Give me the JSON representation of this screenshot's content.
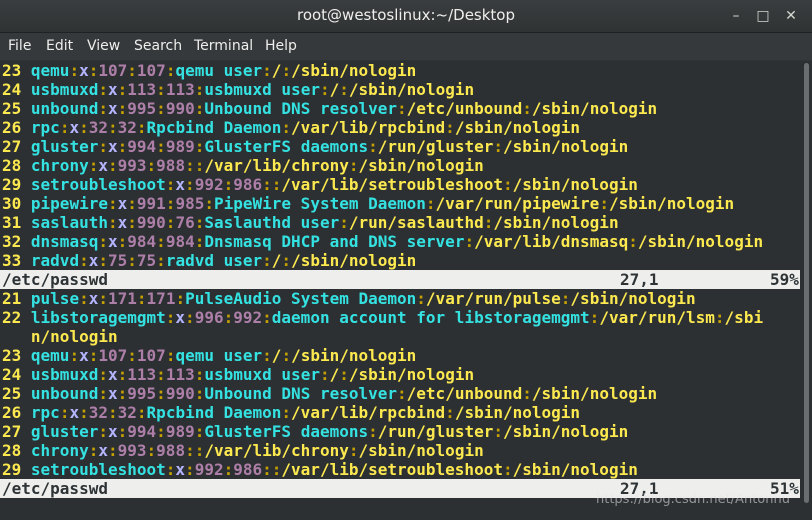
{
  "window": {
    "title": "root@westoslinux:~/Desktop"
  },
  "menu": [
    "File",
    "Edit",
    "View",
    "Search",
    "Terminal",
    "Help"
  ],
  "top_pane": {
    "lines": [
      {
        "n": "23",
        "parts": [
          [
            "user",
            "qemu"
          ],
          [
            "col",
            ":"
          ],
          [
            "x",
            "x"
          ],
          [
            "col",
            ":"
          ],
          [
            "num",
            "107"
          ],
          [
            "col",
            ":"
          ],
          [
            "num",
            "107"
          ],
          [
            "col",
            ":"
          ],
          [
            "desc",
            "qemu user"
          ],
          [
            "col",
            ":"
          ],
          [
            "path",
            "/"
          ],
          [
            "col",
            ":"
          ],
          [
            "path",
            "/sbin/nologin"
          ]
        ]
      },
      {
        "n": "24",
        "parts": [
          [
            "user",
            "usbmuxd"
          ],
          [
            "col",
            ":"
          ],
          [
            "x",
            "x"
          ],
          [
            "col",
            ":"
          ],
          [
            "num",
            "113"
          ],
          [
            "col",
            ":"
          ],
          [
            "num",
            "113"
          ],
          [
            "col",
            ":"
          ],
          [
            "desc",
            "usbmuxd user"
          ],
          [
            "col",
            ":"
          ],
          [
            "path",
            "/"
          ],
          [
            "col",
            ":"
          ],
          [
            "path",
            "/sbin/nologin"
          ]
        ]
      },
      {
        "n": "25",
        "parts": [
          [
            "user",
            "unbound"
          ],
          [
            "col",
            ":"
          ],
          [
            "x",
            "x"
          ],
          [
            "col",
            ":"
          ],
          [
            "num",
            "995"
          ],
          [
            "col",
            ":"
          ],
          [
            "num",
            "990"
          ],
          [
            "col",
            ":"
          ],
          [
            "desc",
            "Unbound DNS resolver"
          ],
          [
            "col",
            ":"
          ],
          [
            "path",
            "/etc/unbound"
          ],
          [
            "col",
            ":"
          ],
          [
            "path",
            "/sbin/nologin"
          ]
        ]
      },
      {
        "n": "26",
        "parts": [
          [
            "user",
            "rpc"
          ],
          [
            "col",
            ":"
          ],
          [
            "x",
            "x"
          ],
          [
            "col",
            ":"
          ],
          [
            "num",
            "32"
          ],
          [
            "col",
            ":"
          ],
          [
            "num",
            "32"
          ],
          [
            "col",
            ":"
          ],
          [
            "desc",
            "Rpcbind Daemon"
          ],
          [
            "col",
            ":"
          ],
          [
            "path",
            "/var/lib/rpcbind"
          ],
          [
            "col",
            ":"
          ],
          [
            "path",
            "/sbin/nologin"
          ]
        ]
      },
      {
        "n": "27",
        "parts": [
          [
            "user",
            "gluster"
          ],
          [
            "col",
            ":"
          ],
          [
            "x",
            "x"
          ],
          [
            "col",
            ":"
          ],
          [
            "num",
            "994"
          ],
          [
            "col",
            ":"
          ],
          [
            "num",
            "989"
          ],
          [
            "col",
            ":"
          ],
          [
            "desc",
            "GlusterFS daemons"
          ],
          [
            "col",
            ":"
          ],
          [
            "path",
            "/run/gluster"
          ],
          [
            "col",
            ":"
          ],
          [
            "path",
            "/sbin/nologin"
          ]
        ]
      },
      {
        "n": "28",
        "parts": [
          [
            "user",
            "chrony"
          ],
          [
            "col",
            ":"
          ],
          [
            "x",
            "x"
          ],
          [
            "col",
            ":"
          ],
          [
            "num",
            "993"
          ],
          [
            "col",
            ":"
          ],
          [
            "num",
            "988"
          ],
          [
            "col",
            "::"
          ],
          [
            "path",
            "/var/lib/chrony"
          ],
          [
            "col",
            ":"
          ],
          [
            "path",
            "/sbin/nologin"
          ]
        ]
      },
      {
        "n": "29",
        "parts": [
          [
            "user",
            "setroubleshoot"
          ],
          [
            "col",
            ":"
          ],
          [
            "x",
            "x"
          ],
          [
            "col",
            ":"
          ],
          [
            "num",
            "992"
          ],
          [
            "col",
            ":"
          ],
          [
            "num",
            "986"
          ],
          [
            "col",
            "::"
          ],
          [
            "path",
            "/var/lib/setroubleshoot"
          ],
          [
            "col",
            ":"
          ],
          [
            "path",
            "/sbin/nologin"
          ]
        ]
      },
      {
        "n": "30",
        "parts": [
          [
            "user",
            "pipewire"
          ],
          [
            "col",
            ":"
          ],
          [
            "x",
            "x"
          ],
          [
            "col",
            ":"
          ],
          [
            "num",
            "991"
          ],
          [
            "col",
            ":"
          ],
          [
            "num",
            "985"
          ],
          [
            "col",
            ":"
          ],
          [
            "desc",
            "PipeWire System Daemon"
          ],
          [
            "col",
            ":"
          ],
          [
            "path",
            "/var/run/pipewire"
          ],
          [
            "col",
            ":"
          ],
          [
            "path",
            "/sbin/nologin"
          ]
        ]
      },
      {
        "n": "31",
        "parts": [
          [
            "user",
            "saslauth"
          ],
          [
            "col",
            ":"
          ],
          [
            "x",
            "x"
          ],
          [
            "col",
            ":"
          ],
          [
            "num",
            "990"
          ],
          [
            "col",
            ":"
          ],
          [
            "num",
            "76"
          ],
          [
            "col",
            ":"
          ],
          [
            "desc",
            "Saslauthd user"
          ],
          [
            "col",
            ":"
          ],
          [
            "path",
            "/run/saslauthd"
          ],
          [
            "col",
            ":"
          ],
          [
            "path",
            "/sbin/nologin"
          ]
        ]
      },
      {
        "n": "32",
        "parts": [
          [
            "user",
            "dnsmasq"
          ],
          [
            "col",
            ":"
          ],
          [
            "x",
            "x"
          ],
          [
            "col",
            ":"
          ],
          [
            "num",
            "984"
          ],
          [
            "col",
            ":"
          ],
          [
            "num",
            "984"
          ],
          [
            "col",
            ":"
          ],
          [
            "desc",
            "Dnsmasq DHCP and DNS server"
          ],
          [
            "col",
            ":"
          ],
          [
            "path",
            "/var/lib/dnsmasq"
          ],
          [
            "col",
            ":"
          ],
          [
            "path",
            "/sbin/nologin"
          ]
        ]
      },
      {
        "n": "33",
        "parts": [
          [
            "user",
            "radvd"
          ],
          [
            "col",
            ":"
          ],
          [
            "x",
            "x"
          ],
          [
            "col",
            ":"
          ],
          [
            "num",
            "75"
          ],
          [
            "col",
            ":"
          ],
          [
            "num",
            "75"
          ],
          [
            "col",
            ":"
          ],
          [
            "desc",
            "radvd user"
          ],
          [
            "col",
            ":"
          ],
          [
            "path",
            "/"
          ],
          [
            "col",
            ":"
          ],
          [
            "path",
            "/sbin/nologin"
          ]
        ]
      }
    ],
    "status": {
      "file": "/etc/passwd",
      "pos": "27,1",
      "pct": "59%"
    }
  },
  "bottom_pane": {
    "lines": [
      {
        "n": "21",
        "parts": [
          [
            "user",
            "pulse"
          ],
          [
            "col",
            ":"
          ],
          [
            "x",
            "x"
          ],
          [
            "col",
            ":"
          ],
          [
            "num",
            "171"
          ],
          [
            "col",
            ":"
          ],
          [
            "num",
            "171"
          ],
          [
            "col",
            ":"
          ],
          [
            "desc",
            "PulseAudio System Daemon"
          ],
          [
            "col",
            ":"
          ],
          [
            "path",
            "/var/run/pulse"
          ],
          [
            "col",
            ":"
          ],
          [
            "path",
            "/sbin/nologin"
          ]
        ]
      },
      {
        "n": "22",
        "parts": [
          [
            "user",
            "libstoragemgmt"
          ],
          [
            "col",
            ":"
          ],
          [
            "x",
            "x"
          ],
          [
            "col",
            ":"
          ],
          [
            "num",
            "996"
          ],
          [
            "col",
            ":"
          ],
          [
            "num",
            "992"
          ],
          [
            "col",
            ":"
          ],
          [
            "desc",
            "daemon account for libstoragemgmt"
          ],
          [
            "col",
            ":"
          ],
          [
            "path",
            "/var/run/lsm"
          ],
          [
            "col",
            ":"
          ],
          [
            "path",
            "/sbi"
          ]
        ]
      },
      {
        "n": "",
        "parts": [
          [
            "path",
            "n/nologin"
          ]
        ]
      },
      {
        "n": "23",
        "parts": [
          [
            "user",
            "qemu"
          ],
          [
            "col",
            ":"
          ],
          [
            "x",
            "x"
          ],
          [
            "col",
            ":"
          ],
          [
            "num",
            "107"
          ],
          [
            "col",
            ":"
          ],
          [
            "num",
            "107"
          ],
          [
            "col",
            ":"
          ],
          [
            "desc",
            "qemu user"
          ],
          [
            "col",
            ":"
          ],
          [
            "path",
            "/"
          ],
          [
            "col",
            ":"
          ],
          [
            "path",
            "/sbin/nologin"
          ]
        ]
      },
      {
        "n": "24",
        "parts": [
          [
            "user",
            "usbmuxd"
          ],
          [
            "col",
            ":"
          ],
          [
            "x",
            "x"
          ],
          [
            "col",
            ":"
          ],
          [
            "num",
            "113"
          ],
          [
            "col",
            ":"
          ],
          [
            "num",
            "113"
          ],
          [
            "col",
            ":"
          ],
          [
            "desc",
            "usbmuxd user"
          ],
          [
            "col",
            ":"
          ],
          [
            "path",
            "/"
          ],
          [
            "col",
            ":"
          ],
          [
            "path",
            "/sbin/nologin"
          ]
        ]
      },
      {
        "n": "25",
        "parts": [
          [
            "user",
            "unbound"
          ],
          [
            "col",
            ":"
          ],
          [
            "x",
            "x"
          ],
          [
            "col",
            ":"
          ],
          [
            "num",
            "995"
          ],
          [
            "col",
            ":"
          ],
          [
            "num",
            "990"
          ],
          [
            "col",
            ":"
          ],
          [
            "desc",
            "Unbound DNS resolver"
          ],
          [
            "col",
            ":"
          ],
          [
            "path",
            "/etc/unbound"
          ],
          [
            "col",
            ":"
          ],
          [
            "path",
            "/sbin/nologin"
          ]
        ]
      },
      {
        "n": "26",
        "parts": [
          [
            "user",
            "rpc"
          ],
          [
            "col",
            ":"
          ],
          [
            "x",
            "x"
          ],
          [
            "col",
            ":"
          ],
          [
            "num",
            "32"
          ],
          [
            "col",
            ":"
          ],
          [
            "num",
            "32"
          ],
          [
            "col",
            ":"
          ],
          [
            "desc",
            "Rpcbind Daemon"
          ],
          [
            "col",
            ":"
          ],
          [
            "path",
            "/var/lib/rpcbind"
          ],
          [
            "col",
            ":"
          ],
          [
            "path",
            "/sbin/nologin"
          ]
        ]
      },
      {
        "n": "27",
        "parts": [
          [
            "user",
            "gluster"
          ],
          [
            "col",
            ":"
          ],
          [
            "x",
            "x"
          ],
          [
            "col",
            ":"
          ],
          [
            "num",
            "994"
          ],
          [
            "col",
            ":"
          ],
          [
            "num",
            "989"
          ],
          [
            "col",
            ":"
          ],
          [
            "desc",
            "GlusterFS daemons"
          ],
          [
            "col",
            ":"
          ],
          [
            "path",
            "/run/gluster"
          ],
          [
            "col",
            ":"
          ],
          [
            "path",
            "/sbin/nologin"
          ]
        ]
      },
      {
        "n": "28",
        "parts": [
          [
            "user",
            "chrony"
          ],
          [
            "col",
            ":"
          ],
          [
            "x",
            "x"
          ],
          [
            "col",
            ":"
          ],
          [
            "num",
            "993"
          ],
          [
            "col",
            ":"
          ],
          [
            "num",
            "988"
          ],
          [
            "col",
            "::"
          ],
          [
            "path",
            "/var/lib/chrony"
          ],
          [
            "col",
            ":"
          ],
          [
            "path",
            "/sbin/nologin"
          ]
        ]
      },
      {
        "n": "29",
        "parts": [
          [
            "user",
            "setroubleshoot"
          ],
          [
            "col",
            ":"
          ],
          [
            "x",
            "x"
          ],
          [
            "col",
            ":"
          ],
          [
            "num",
            "992"
          ],
          [
            "col",
            ":"
          ],
          [
            "num",
            "986"
          ],
          [
            "col",
            "::"
          ],
          [
            "path",
            "/var/lib/setroubleshoot"
          ],
          [
            "col",
            ":"
          ],
          [
            "path",
            "/sbin/nologin"
          ]
        ]
      }
    ],
    "status": {
      "file": "/etc/passwd",
      "pos": "27,1",
      "pct": "51%"
    }
  },
  "watermark": "https://blog.csdn.net/Antonhu"
}
